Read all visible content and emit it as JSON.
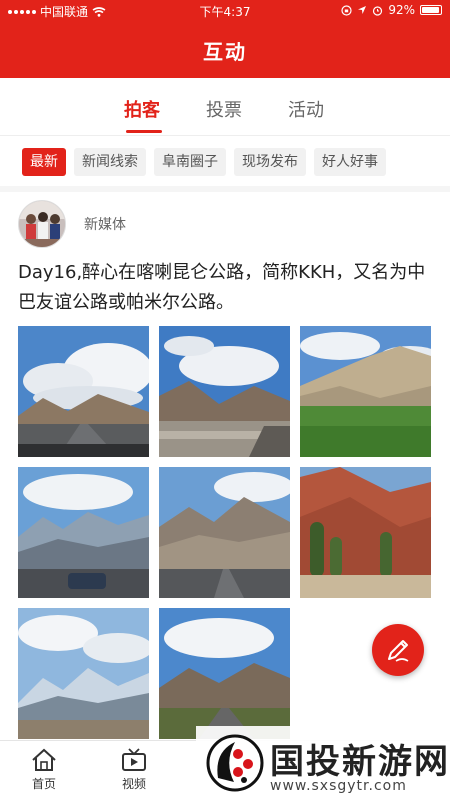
{
  "status_bar": {
    "carrier": "中国联通",
    "time": "下午4:37",
    "battery": "92%"
  },
  "header": {
    "title": "互动"
  },
  "tabs": [
    {
      "label": "拍客",
      "active": true
    },
    {
      "label": "投票",
      "active": false
    },
    {
      "label": "活动",
      "active": false
    }
  ],
  "chips": [
    {
      "label": "最新",
      "active": true
    },
    {
      "label": "新闻线索",
      "active": false
    },
    {
      "label": "阜南圈子",
      "active": false
    },
    {
      "label": "现场发布",
      "active": false
    },
    {
      "label": "好人好事",
      "active": false
    }
  ],
  "post": {
    "author": "新媒体",
    "text": "Day16,醉心在喀喇昆仑公路，简称KKH，又名为中巴友谊公路或帕米尔公路。",
    "photos": [
      {
        "name": "photo-1",
        "theme": "road-clouds"
      },
      {
        "name": "photo-2",
        "theme": "mountain-road"
      },
      {
        "name": "photo-3",
        "theme": "green-valley"
      },
      {
        "name": "photo-4",
        "theme": "snow-mountain-road"
      },
      {
        "name": "photo-5",
        "theme": "highway-mountain"
      },
      {
        "name": "photo-6",
        "theme": "red-rock-trees"
      },
      {
        "name": "photo-7",
        "theme": "snow-peak"
      },
      {
        "name": "photo-8",
        "theme": "road-hills"
      }
    ]
  },
  "fab": {
    "icon": "pen-icon"
  },
  "bottom_nav": [
    {
      "label": "首页",
      "icon": "home-icon"
    },
    {
      "label": "视频",
      "icon": "tv-icon"
    }
  ],
  "watermark": {
    "title": "国投新游网",
    "url": "www.sxsgytr.com"
  },
  "colors": {
    "accent": "#e2231a"
  }
}
